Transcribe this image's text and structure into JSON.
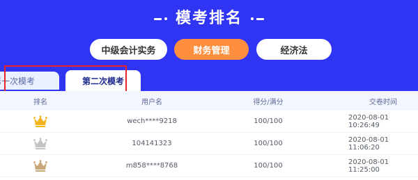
{
  "header": {
    "title": "模考排名",
    "background_color": "#2f35f3",
    "title_decoration": "dash-dot"
  },
  "subjects": [
    {
      "label": "中级会计实务",
      "active": false
    },
    {
      "label": "财务管理",
      "active": true
    },
    {
      "label": "经济法",
      "active": false
    }
  ],
  "tabs": [
    {
      "label": "第一次模考",
      "active": false
    },
    {
      "label": "第二次模考",
      "active": true
    }
  ],
  "table": {
    "columns": [
      "排名",
      "用户名",
      "得分/满分",
      "交卷时间"
    ],
    "rows": [
      {
        "rank_icon": "gold-crown-icon",
        "user": "wech****9218",
        "score": "100/100",
        "time": "2020-08-01 10:26:49"
      },
      {
        "rank_icon": "silver-crown-icon",
        "user": "104141323",
        "score": "100/100",
        "time": "2020-08-01 11:06:20"
      },
      {
        "rank_icon": "bronze-crown-icon",
        "user": "m858****8768",
        "score": "100/100",
        "time": "2020-08-01 11:25:00"
      }
    ]
  },
  "colors": {
    "accent_orange": "#ff8f3f",
    "highlight_red": "#e8242b",
    "gold": "#f2b51d",
    "silver": "#c4c4c4",
    "bronze": "#c9a57a"
  }
}
